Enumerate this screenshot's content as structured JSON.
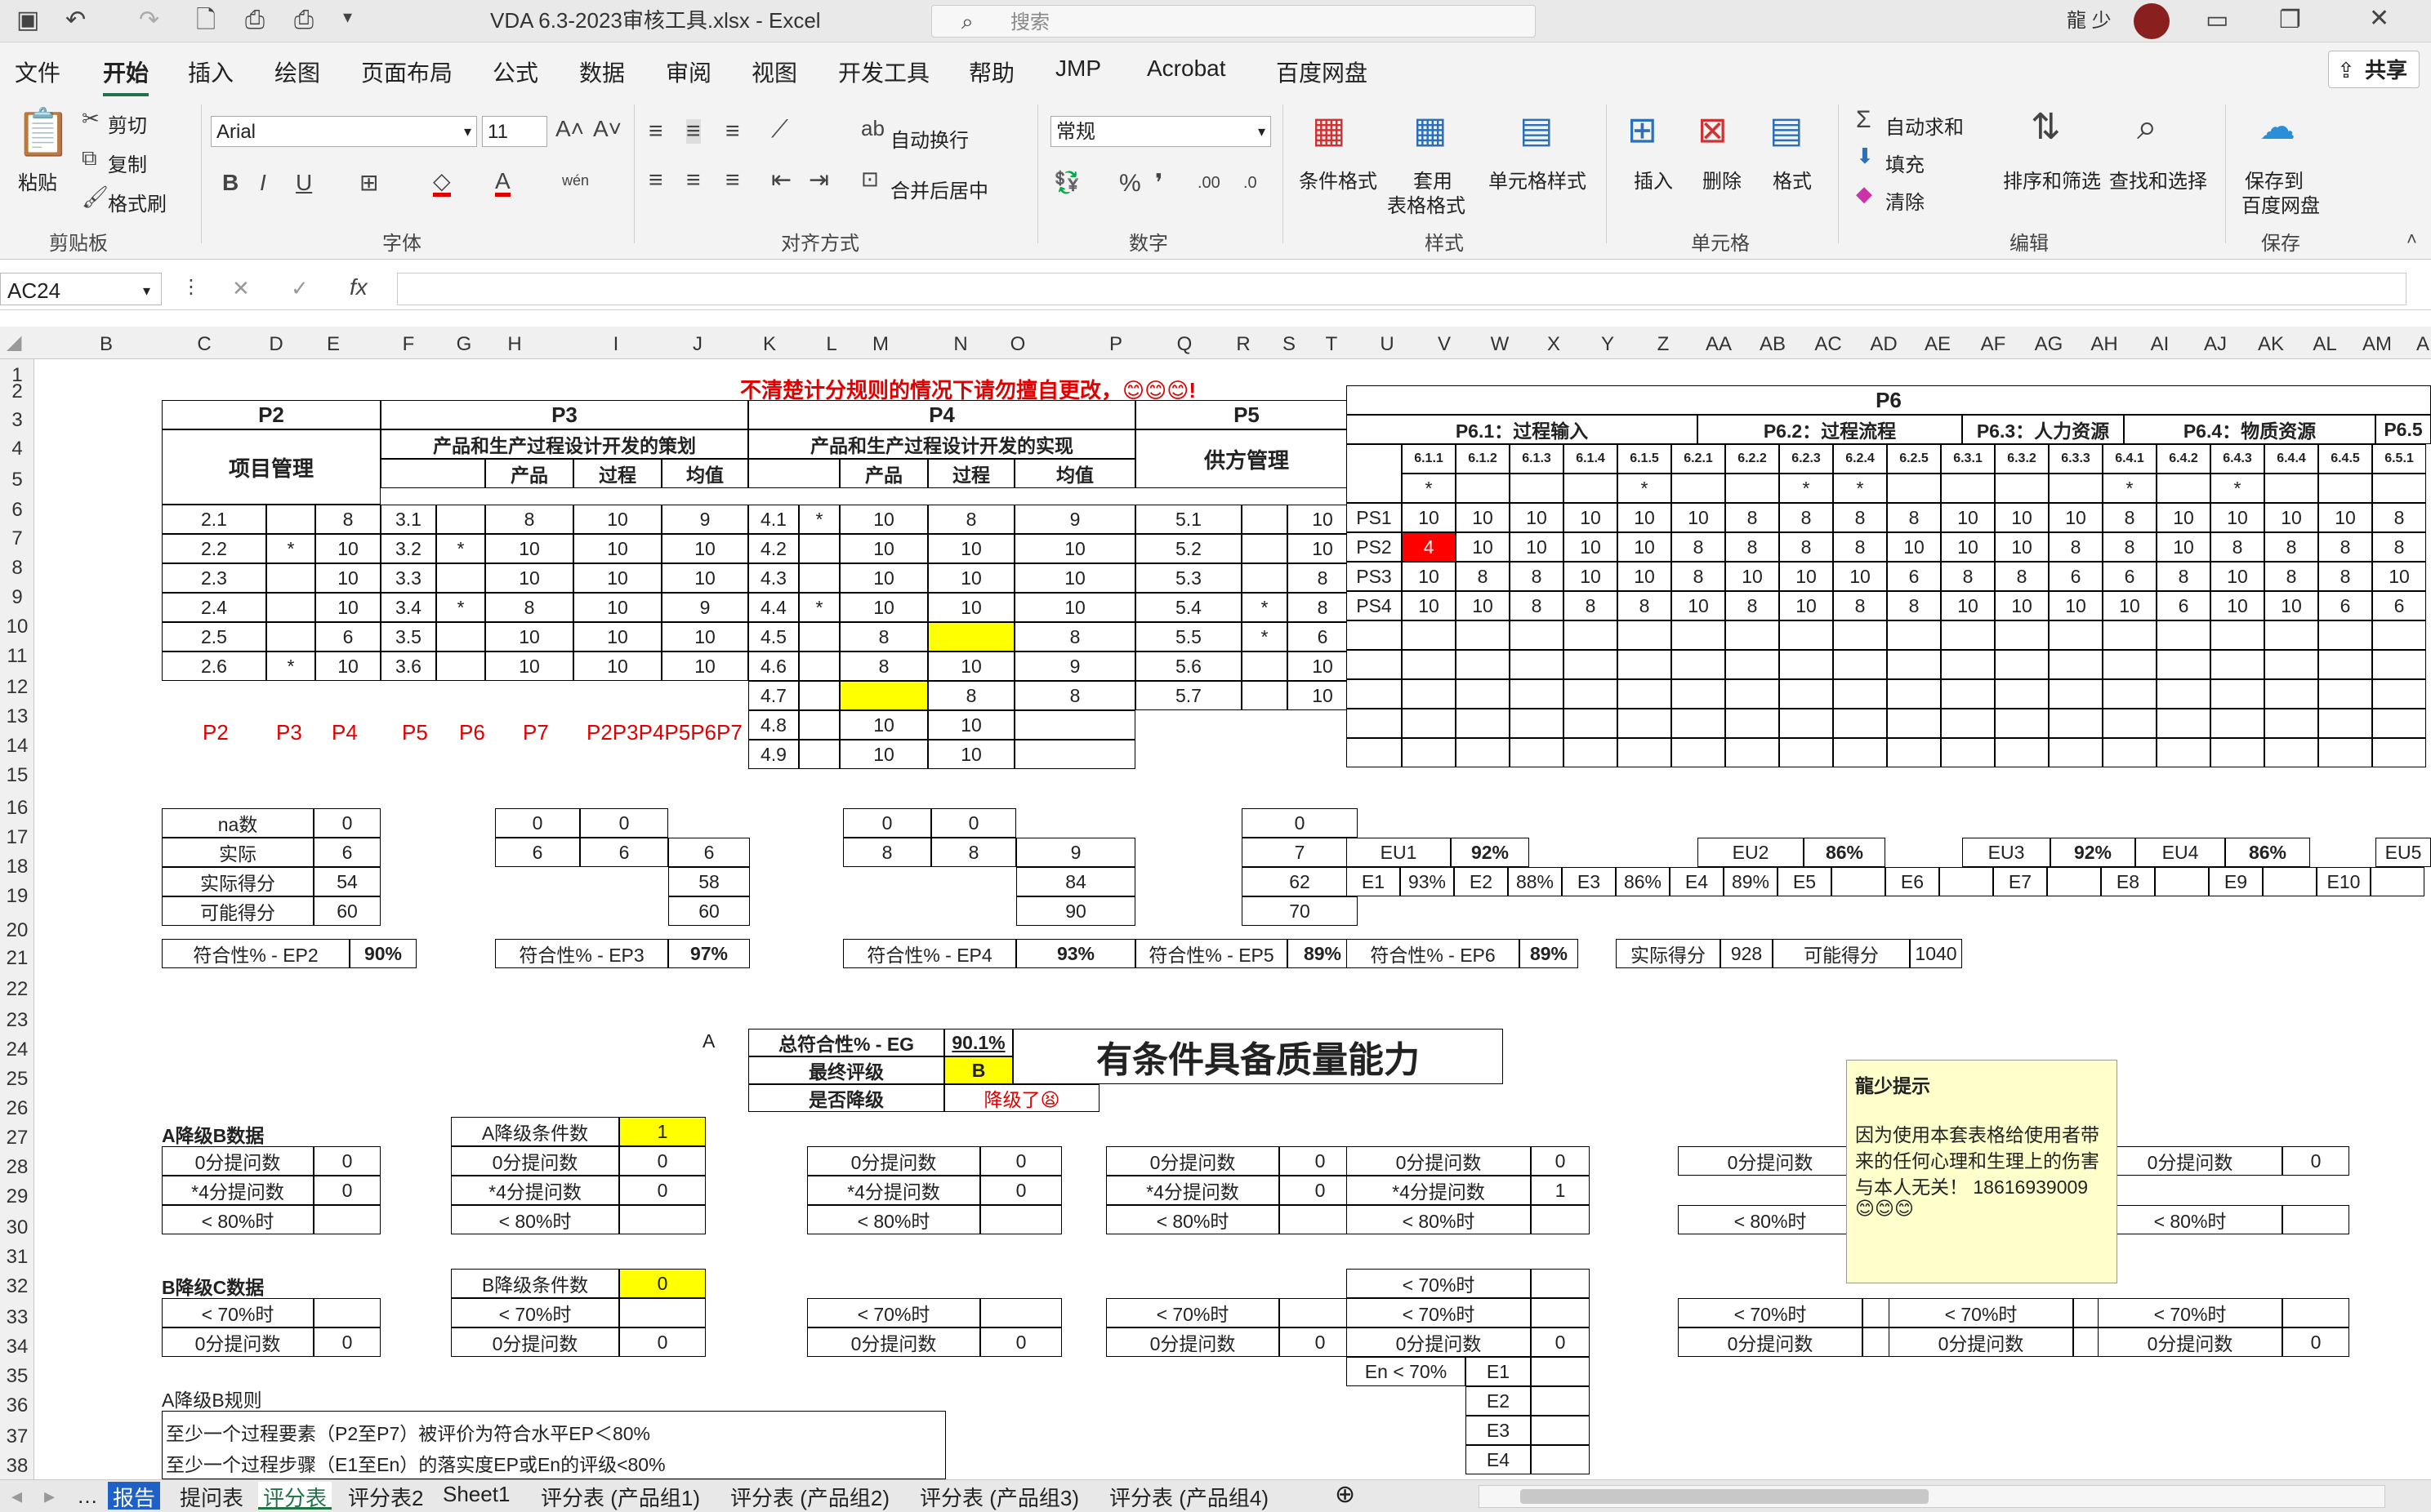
{
  "window": {
    "title": "VDA 6.3-2023审核工具.xlsx  -  Excel",
    "search_placeholder": "搜索",
    "user": "龍 少"
  },
  "menu": [
    "文件",
    "开始",
    "插入",
    "绘图",
    "页面布局",
    "公式",
    "数据",
    "审阅",
    "视图",
    "开发工具",
    "帮助",
    "JMP",
    "Acrobat",
    "百度网盘"
  ],
  "share": "共享",
  "ribbon": {
    "clipboard": {
      "paste": "粘贴",
      "cut": "剪切",
      "copy": "复制",
      "format_painter": "格式刷",
      "group": "剪贴板"
    },
    "font": {
      "name": "Arial",
      "size": "11",
      "group": "字体"
    },
    "alignment": {
      "wrap": "自动换行",
      "merge": "合并后居中",
      "group": "对齐方式"
    },
    "number": {
      "format": "常规",
      "group": "数字"
    },
    "styles": {
      "cond": "条件格式",
      "table1": "套用",
      "table2": "表格格式",
      "cellstyle": "单元格样式",
      "group": "样式"
    },
    "cells": {
      "insert": "插入",
      "delete": "删除",
      "format": "格式",
      "group": "单元格"
    },
    "editing": {
      "autosum": "自动求和",
      "fill": "填充",
      "clear": "清除",
      "sort": "排序和筛选",
      "find": "查找和选择",
      "group": "编辑"
    },
    "save": {
      "l1": "保存到",
      "l2": "百度网盘",
      "group": "保存"
    }
  },
  "formula": {
    "namebox": "AC24",
    "fx": "fx"
  },
  "columns": [
    "B",
    "C",
    "D",
    "E",
    "F",
    "G",
    "H",
    "I",
    "J",
    "K",
    "L",
    "M",
    "N",
    "O",
    "P",
    "Q",
    "R",
    "S",
    "T",
    "U",
    "V",
    "W",
    "X",
    "Y",
    "Z",
    "AA",
    "AB",
    "AC",
    "AD",
    "AE",
    "AF",
    "AG",
    "AH",
    "AI",
    "AJ",
    "AK",
    "AL",
    "AM",
    "A"
  ],
  "rows": [
    "1",
    "2",
    "3",
    "4",
    "5",
    "6",
    "7",
    "8",
    "9",
    "10",
    "11",
    "12",
    "13",
    "14",
    "15",
    "16",
    "17",
    "18",
    "19",
    "20",
    "21",
    "22",
    "23",
    "24",
    "25",
    "26",
    "27",
    "28",
    "29",
    "30",
    "31",
    "32",
    "33",
    "34",
    "35",
    "36",
    "37",
    "38"
  ],
  "sheet": {
    "warning": "不清楚计分规则的情况下请勿擅自更改，😊😊😊!",
    "p2": {
      "title": "P2",
      "sub": "项目管理",
      "rows": [
        [
          "2.1",
          "",
          "8"
        ],
        [
          "2.2",
          "*",
          "10"
        ],
        [
          "2.3",
          "",
          "10"
        ],
        [
          "2.4",
          "",
          "10"
        ],
        [
          "2.5",
          "",
          "6"
        ],
        [
          "2.6",
          "*",
          "10"
        ]
      ]
    },
    "p3": {
      "title": "P3",
      "sub": "产品和生产过程设计开发的策划",
      "h1": "产品",
      "h2": "过程",
      "h3": "均值",
      "rows": [
        [
          "3.1",
          "",
          "8",
          "10",
          "9"
        ],
        [
          "3.2",
          "*",
          "10",
          "10",
          "10"
        ],
        [
          "3.3",
          "",
          "10",
          "10",
          "10"
        ],
        [
          "3.4",
          "*",
          "8",
          "10",
          "9"
        ],
        [
          "3.5",
          "",
          "10",
          "10",
          "10"
        ],
        [
          "3.6",
          "",
          "10",
          "10",
          "10"
        ]
      ]
    },
    "p4": {
      "title": "P4",
      "sub": "产品和生产过程设计开发的实现",
      "h1": "产品",
      "h2": "过程",
      "h3": "均值",
      "rows": [
        [
          "4.1",
          "*",
          "10",
          "8",
          "9"
        ],
        [
          "4.2",
          "",
          "10",
          "10",
          "10"
        ],
        [
          "4.3",
          "",
          "10",
          "10",
          "10"
        ],
        [
          "4.4",
          "*",
          "10",
          "10",
          "10"
        ],
        [
          "4.5",
          "",
          "8",
          "",
          "8"
        ],
        [
          "4.6",
          "",
          "8",
          "10",
          "9"
        ],
        [
          "4.7",
          "",
          "",
          "8",
          "8"
        ],
        [
          "4.8",
          "",
          "10",
          "10",
          ""
        ],
        [
          "4.9",
          "",
          "10",
          "10",
          ""
        ]
      ]
    },
    "p5": {
      "title": "P5",
      "sub": "供方管理",
      "rows": [
        [
          "5.1",
          "",
          "10"
        ],
        [
          "5.2",
          "",
          "10"
        ],
        [
          "5.3",
          "",
          "8"
        ],
        [
          "5.4",
          "*",
          "8"
        ],
        [
          "5.5",
          "*",
          "6"
        ],
        [
          "5.6",
          "",
          "10"
        ],
        [
          "5.7",
          "",
          "10"
        ]
      ]
    },
    "red_labels": [
      "P2",
      "P3",
      "P4",
      "P5",
      "P6",
      "P7",
      "P2P3P4P5P6P7"
    ],
    "p6": {
      "title": "P6",
      "groups": [
        "P6.1：过程输入",
        "P6.2：过程流程",
        "P6.3：人力资源",
        "P6.4：物质资源",
        "P6.5"
      ],
      "codes": [
        "6.1.1",
        "6.1.2",
        "6.1.3",
        "6.1.4",
        "6.1.5",
        "6.2.1",
        "6.2.2",
        "6.2.3",
        "6.2.4",
        "6.2.5",
        "6.3.1",
        "6.3.2",
        "6.3.3",
        "6.4.1",
        "6.4.2",
        "6.4.3",
        "6.4.4",
        "6.4.5",
        "6.5.1"
      ],
      "stars": [
        "*",
        "",
        "",
        "",
        "*",
        "",
        "",
        "*",
        "*",
        "",
        "",
        "",
        "",
        "*",
        "",
        "*",
        "",
        "",
        ""
      ],
      "rows": [
        [
          "PS1",
          "10",
          "10",
          "10",
          "10",
          "10",
          "10",
          "8",
          "8",
          "8",
          "8",
          "10",
          "10",
          "10",
          "8",
          "10",
          "10",
          "10",
          "10",
          "8"
        ],
        [
          "PS2",
          "4",
          "10",
          "10",
          "10",
          "10",
          "8",
          "8",
          "8",
          "8",
          "10",
          "10",
          "10",
          "8",
          "8",
          "10",
          "8",
          "8",
          "8",
          "8"
        ],
        [
          "PS3",
          "10",
          "8",
          "8",
          "10",
          "10",
          "8",
          "10",
          "10",
          "10",
          "6",
          "8",
          "8",
          "6",
          "6",
          "8",
          "10",
          "8",
          "8",
          "10"
        ],
        [
          "PS4",
          "10",
          "10",
          "8",
          "8",
          "8",
          "10",
          "8",
          "10",
          "8",
          "8",
          "10",
          "10",
          "10",
          "10",
          "6",
          "10",
          "10",
          "6",
          "6"
        ]
      ]
    },
    "summary": {
      "na": "na数",
      "actual": "实际",
      "actual_score": "实际得分",
      "possible": "可能得分",
      "p2": [
        "0",
        "6",
        "54",
        "60"
      ],
      "p3a": [
        "0",
        "6"
      ],
      "p3b": [
        "0",
        "6"
      ],
      "p3c": [
        "6",
        "58",
        "60"
      ],
      "p4a": [
        "0",
        "8"
      ],
      "p4b": [
        "0",
        "8"
      ],
      "p4c": [
        "9",
        "84",
        "90"
      ],
      "p5": [
        "0",
        "7",
        "62",
        "70"
      ]
    },
    "eu": [
      [
        "EU1",
        "92%"
      ],
      [
        "EU2",
        "86%"
      ],
      [
        "EU3",
        "92%"
      ],
      [
        "EU4",
        "86%"
      ],
      [
        "EU5",
        ""
      ]
    ],
    "e_row": [
      [
        "E1",
        "93%"
      ],
      [
        "E2",
        "88%"
      ],
      [
        "E3",
        "86%"
      ],
      [
        "E4",
        "89%"
      ],
      [
        "E5",
        ""
      ],
      [
        "E6",
        ""
      ],
      [
        "E7",
        ""
      ],
      [
        "E8",
        ""
      ],
      [
        "E9",
        ""
      ],
      [
        "E10",
        ""
      ]
    ],
    "conf": [
      [
        "符合性% - EP2",
        "90%"
      ],
      [
        "符合性% - EP3",
        "97%"
      ],
      [
        "符合性% - EP4",
        "93%"
      ],
      [
        "符合性% - EP5",
        "89%"
      ],
      [
        "符合性% - EP6",
        "89%"
      ]
    ],
    "score_total": {
      "l1": "实际得分",
      "v1": "928",
      "l2": "可能得分",
      "v2": "1040"
    },
    "result": {
      "a": "A",
      "eg_label": "总符合性% - EG",
      "eg": "90.1%",
      "final_label": "最终评级",
      "final": "B",
      "down_label": "是否降级",
      "down": "降级了😫",
      "big": "有条件具备质量能力"
    },
    "ab": {
      "title": "A降级B数据",
      "cond": "A降级条件数",
      "cond_v": "1",
      "zero": "0分提问数",
      "star4": "*4分提问数",
      "lt80": "< 80%时",
      "lt70": "< 70%时",
      "p2": [
        "0",
        "0"
      ],
      "p3": [
        "0",
        "0"
      ],
      "p4": [
        "0",
        "0"
      ],
      "p5": [
        "0",
        "0"
      ],
      "p6": [
        "0",
        "1"
      ],
      "u2": [
        "0"
      ],
      "u3": [
        "0"
      ],
      "u4": [
        "0"
      ]
    },
    "bc": {
      "title": "B降级C数据",
      "cond": "B降级条件数",
      "cond_v": "0",
      "vals": [
        "0",
        "0",
        "0",
        "0",
        "0",
        "0",
        "0",
        "0"
      ]
    },
    "en": [
      "En < 70%",
      "E1",
      "E2",
      "E3",
      "E4"
    ],
    "rules": {
      "title": "A降级B规则",
      "r1": "至少一个过程要素（P2至P7）被评价为符合水平EP＜80%",
      "r2": "至少一个过程步骤（E1至En）的落实度EP或En的评级<80%"
    },
    "tooltip": {
      "title": "龍少提示",
      "body1": "因为使用本套表格给使用者带",
      "body2": "来的任何心理和生理上的伤害",
      "body3": "与本人无关！ 18616939009",
      "emoji": "😊😊😊"
    }
  },
  "tabs": [
    "报告",
    "提问表",
    "评分表",
    "评分表2",
    "Sheet1",
    "评分表 (产品组1)",
    "评分表 (产品组2)",
    "评分表 (产品组3)",
    "评分表 (产品组4)"
  ]
}
